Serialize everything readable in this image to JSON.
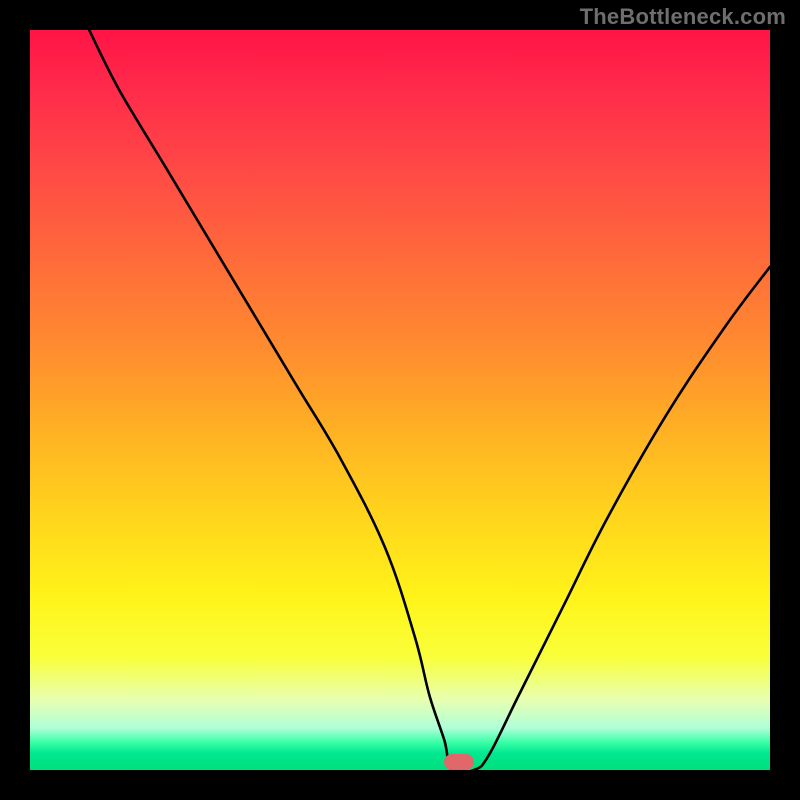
{
  "attribution": "TheBottleneck.com",
  "chart_data": {
    "type": "line",
    "title": "",
    "xlabel": "",
    "ylabel": "",
    "xlim": [
      0,
      100
    ],
    "ylim": [
      0,
      100
    ],
    "grid": false,
    "legend": false,
    "background_gradient": [
      "#ff1446",
      "#ff6a3a",
      "#ffd41c",
      "#f9ff3a",
      "#00e07c"
    ],
    "series": [
      {
        "name": "bottleneck-curve",
        "color": "#000000",
        "x": [
          8,
          12,
          18,
          24,
          30,
          36,
          42,
          48,
          52,
          54,
          56,
          57,
          60,
          62,
          66,
          72,
          78,
          86,
          94,
          100
        ],
        "values": [
          100,
          92,
          82,
          72,
          62,
          52,
          42,
          30,
          18,
          10,
          4,
          0,
          0,
          2,
          10,
          22,
          34,
          48,
          60,
          68
        ]
      }
    ],
    "marker": {
      "name": "optimal-point",
      "x": 58,
      "y": 0,
      "color": "#e06868"
    }
  }
}
